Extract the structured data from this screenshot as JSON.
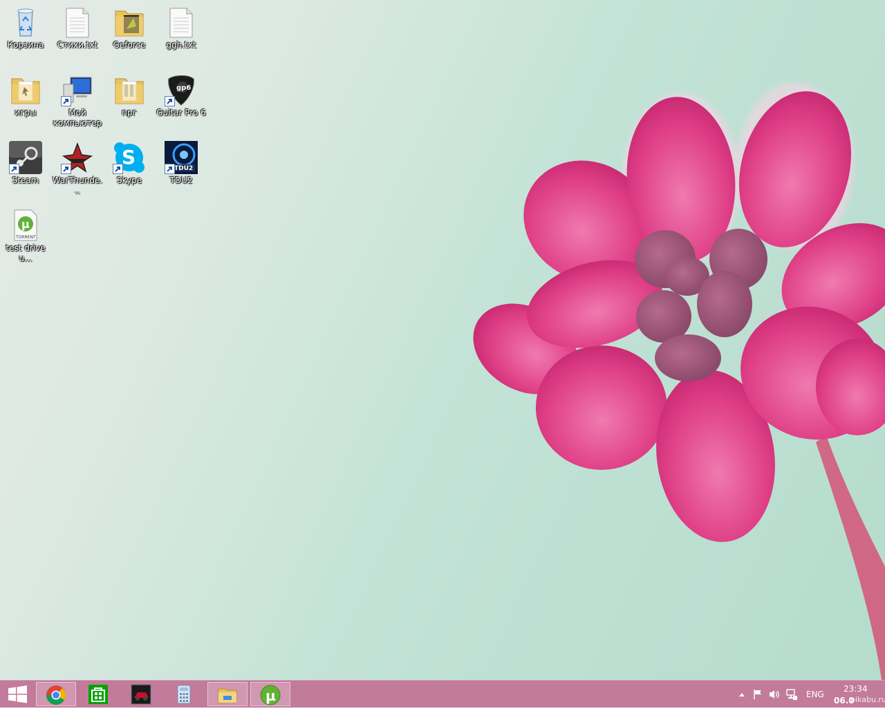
{
  "desktop": {
    "icons": [
      {
        "label": "Корзина"
      },
      {
        "label": "Стихи.txt"
      },
      {
        "label": "Geforce"
      },
      {
        "label": "ggh.txt"
      },
      {
        "label": "игры"
      },
      {
        "label": "Мой компьютер"
      },
      {
        "label": "прг"
      },
      {
        "label": "Guitar Pro 6"
      },
      {
        "label": "Steam"
      },
      {
        "label": "WarThunde..."
      },
      {
        "label": "Skype"
      },
      {
        "label": "TDU2"
      },
      {
        "label": "test drive u..."
      }
    ]
  },
  "taskbar": {
    "apps": [
      {
        "name": "Google Chrome"
      },
      {
        "name": "Windows Store"
      },
      {
        "name": "Racing game"
      },
      {
        "name": "Calculator"
      },
      {
        "name": "File Explorer"
      },
      {
        "name": "uTorrent"
      }
    ],
    "tray": {
      "language": "ENG",
      "time": "23:34",
      "date": "06.0",
      "watermark": "pikabu.ru"
    }
  },
  "colors": {
    "taskbar": "#c37b9b",
    "petal": "#e0468a",
    "background": "#c2e2d6"
  }
}
